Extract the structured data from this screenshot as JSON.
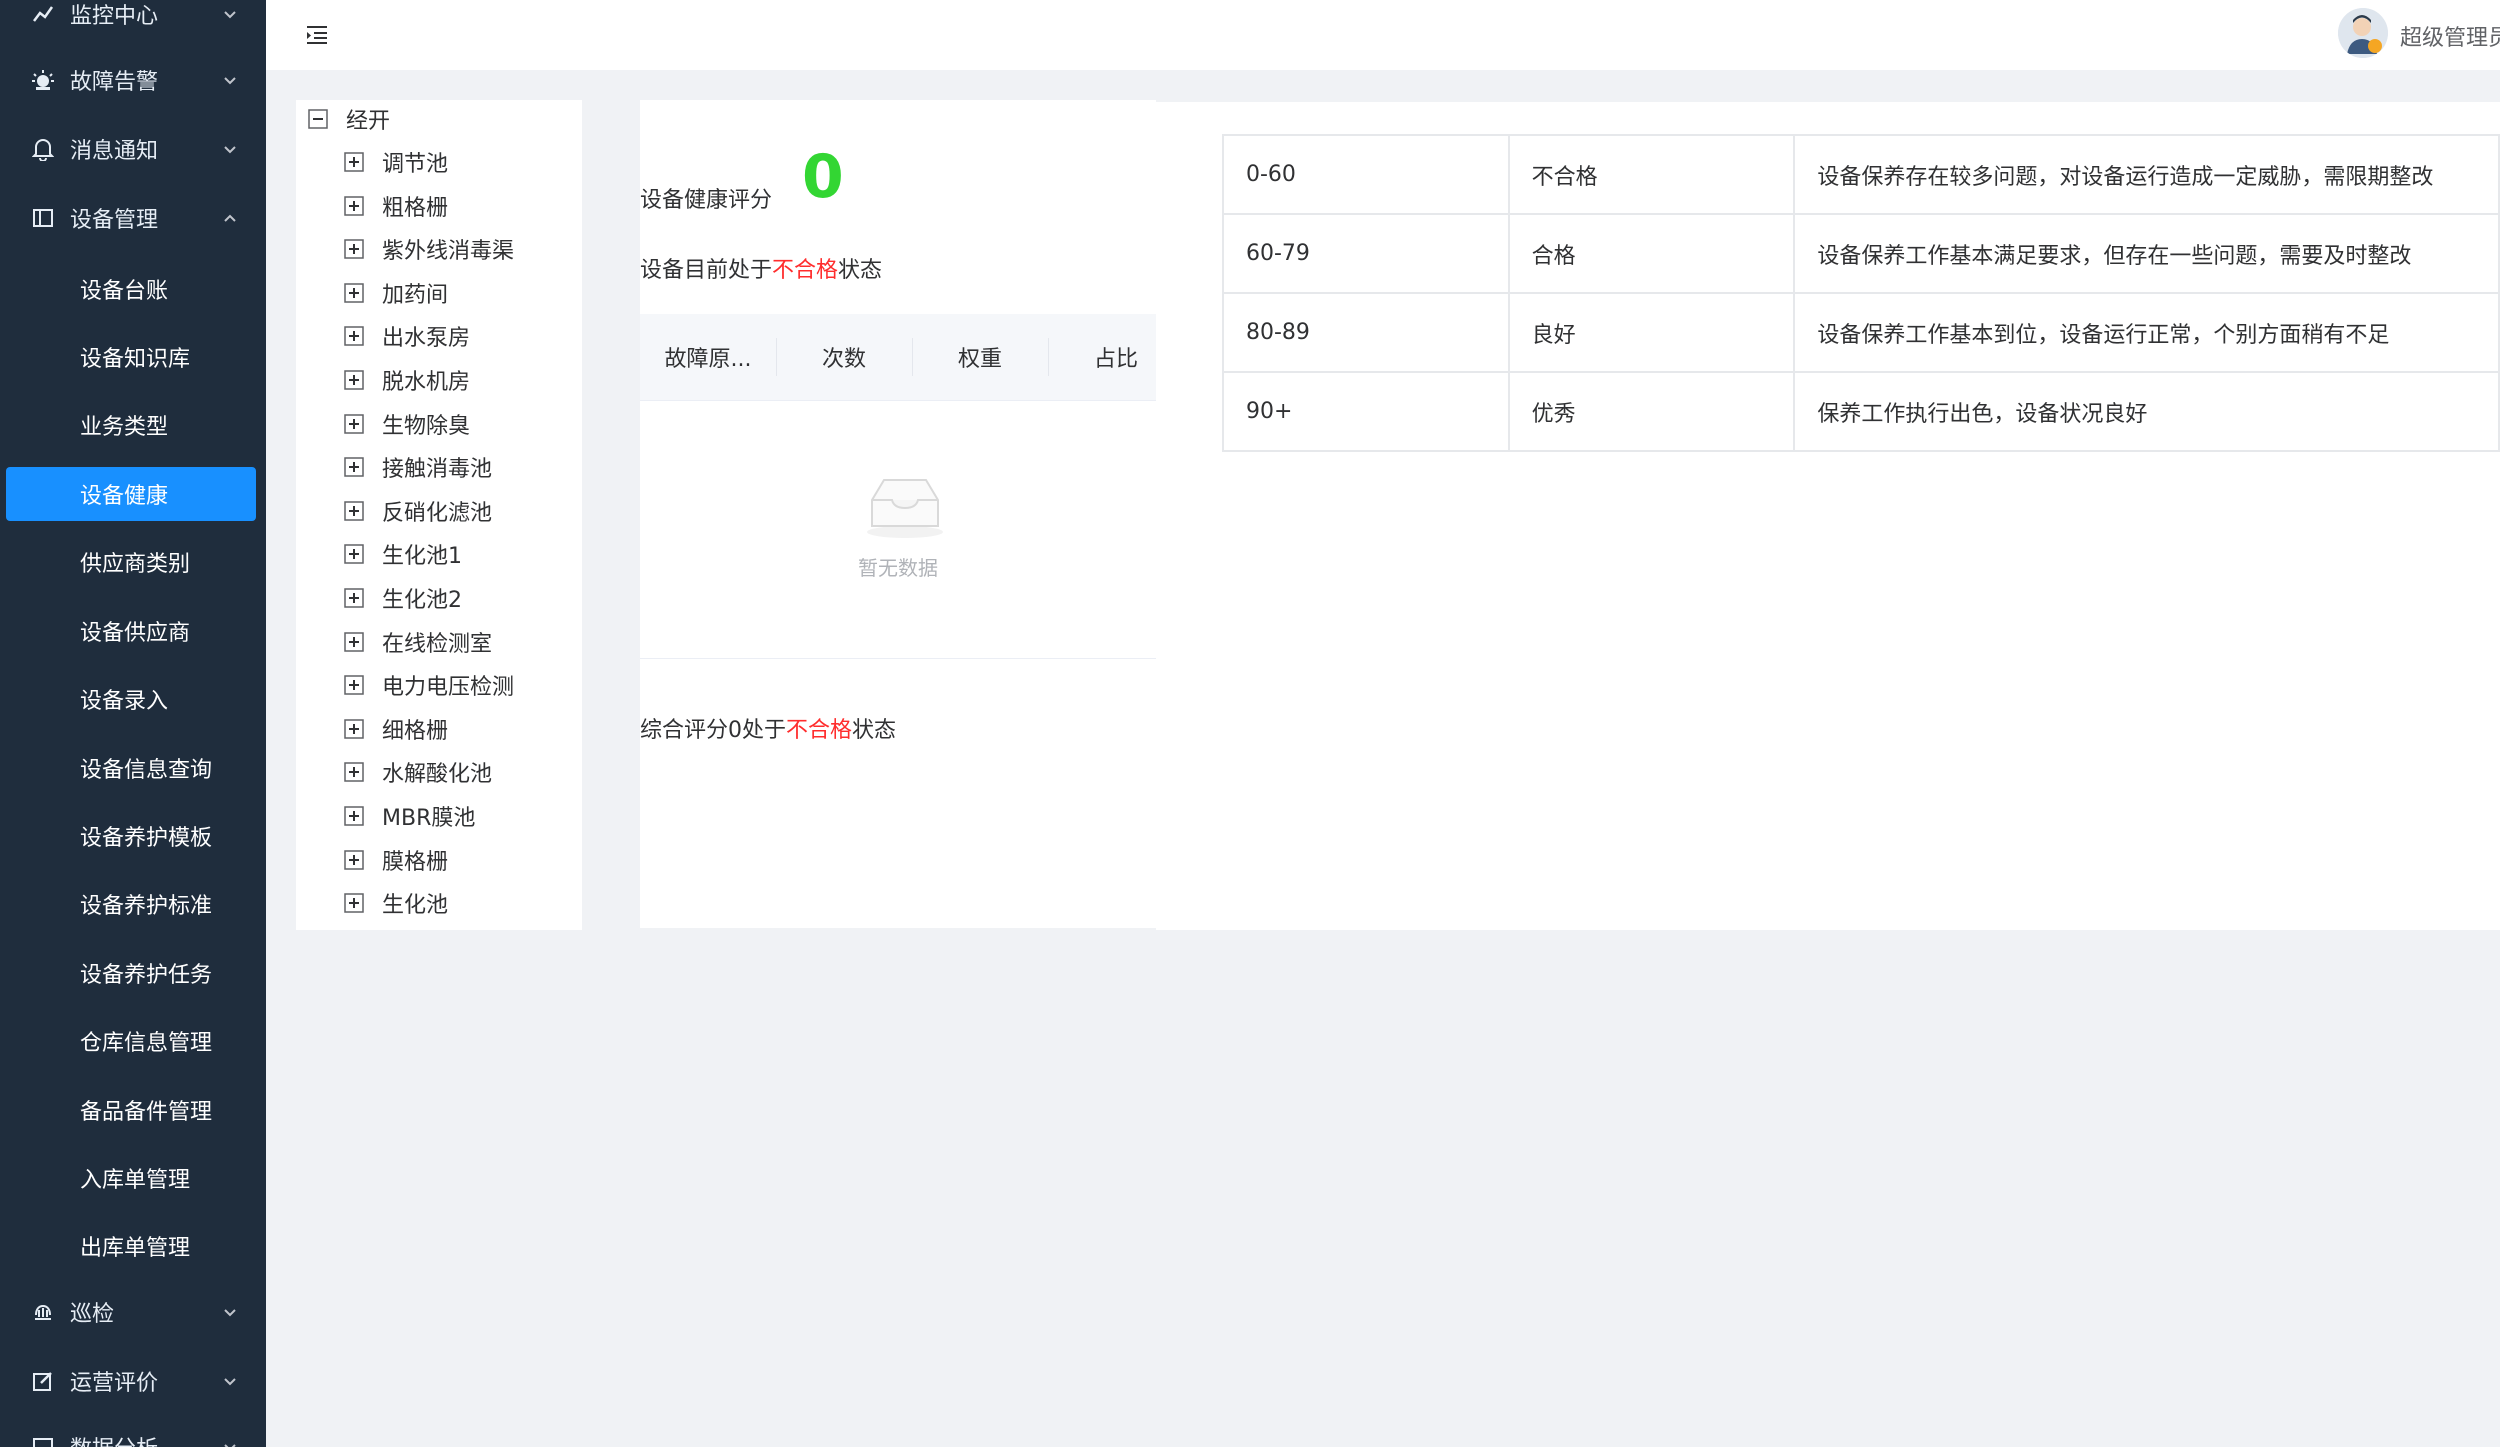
{
  "sidebar": {
    "groups": [
      {
        "label": "监控中心",
        "icon": "chart-icon"
      },
      {
        "label": "故障告警",
        "icon": "alarm-icon"
      },
      {
        "label": "消息通知",
        "icon": "bell-icon"
      },
      {
        "label": "设备管理",
        "icon": "device-icon"
      },
      {
        "label": "巡检",
        "icon": "patrol-icon"
      },
      {
        "label": "运营评价",
        "icon": "edit-icon"
      },
      {
        "label": "数据分析",
        "icon": "data-icon"
      }
    ],
    "items": [
      {
        "label": "设备台账"
      },
      {
        "label": "设备知识库"
      },
      {
        "label": "业务类型"
      },
      {
        "label": "设备健康",
        "active": true
      },
      {
        "label": "供应商类别"
      },
      {
        "label": "设备供应商"
      },
      {
        "label": "设备录入"
      },
      {
        "label": "设备信息查询"
      },
      {
        "label": "设备养护模板"
      },
      {
        "label": "设备养护标准"
      },
      {
        "label": "设备养护任务"
      },
      {
        "label": "仓库信息管理"
      },
      {
        "label": "备品备件管理"
      },
      {
        "label": "入库单管理"
      },
      {
        "label": "出库单管理"
      }
    ]
  },
  "header": {
    "user_name": "超级管理员"
  },
  "tree": {
    "root": "经开",
    "children": [
      "调节池",
      "粗格栅",
      "紫外线消毒渠",
      "加药间",
      "出水泵房",
      "脱水机房",
      "生物除臭",
      "接触消毒池",
      "反硝化滤池",
      "生化池1",
      "生化池2",
      "在线检测室",
      "电力电压检测",
      "细格栅",
      "水解酸化池",
      "MBR膜池",
      "膜格栅",
      "生化池"
    ]
  },
  "health": {
    "score_label": "设备健康评分",
    "score_value": "0",
    "status_prefix": "设备目前处于",
    "status_value": "不合格",
    "status_suffix": "状态",
    "columns": [
      "故障原...",
      "次数",
      "权重",
      "占比"
    ],
    "empty_text": "暂无数据",
    "summary_prefix": "综合评分0处于",
    "summary_value": "不合格",
    "summary_suffix": "状态"
  },
  "grade_table": {
    "rows": [
      [
        "0-60",
        "不合格",
        "设备保养存在较多问题，对设备运行造成一定威胁，需限期整改"
      ],
      [
        "60-79",
        "合格",
        "设备保养工作基本满足要求，但存在一些问题，需要及时整改"
      ],
      [
        "80-89",
        "良好",
        "设备保养工作基本到位，设备运行正常，个别方面稍有不足"
      ],
      [
        "90+",
        "优秀",
        "保养工作执行出色，设备状况良好"
      ]
    ]
  },
  "colors": {
    "sidebar_bg": "#1f2d3d",
    "active_item": "#1890ff",
    "score_green": "#33d633",
    "status_red": "#ff2d2d"
  }
}
